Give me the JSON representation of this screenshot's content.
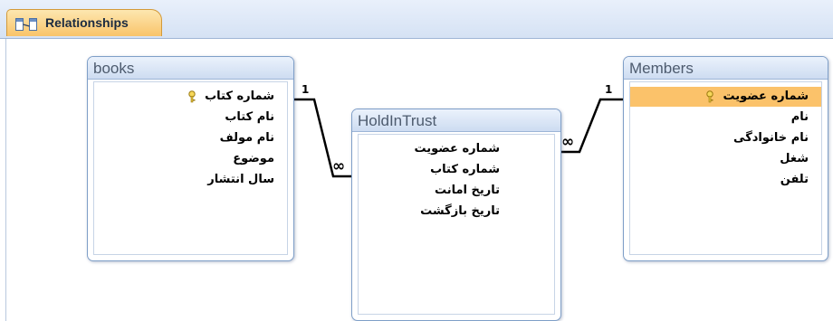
{
  "tab": {
    "label": "Relationships",
    "icon": "relationships-icon"
  },
  "tables": {
    "books": {
      "title": "books",
      "fields": [
        "شماره کتاب",
        "نام کتاب",
        "نام مولف",
        "موضوع",
        "سال انتشار"
      ],
      "primary_key": "شماره کتاب"
    },
    "holdintrust": {
      "title": "HoldInTrust",
      "fields": [
        "شماره عضويت",
        "شماره كتاب",
        "تاريخ امانت",
        "تاريخ بازگشت"
      ]
    },
    "members": {
      "title": "Members",
      "fields": [
        "شماره عضويت",
        "نام",
        "نام خانوادگی",
        "شغل",
        "تلفن"
      ],
      "primary_key": "شماره عضويت",
      "selected_field": "شماره عضويت"
    }
  },
  "relationships": [
    {
      "from": "books",
      "to": "HoldInTrust",
      "one_label": "1",
      "many_label": "∞"
    },
    {
      "from": "Members",
      "to": "HoldInTrust",
      "one_label": "1",
      "many_label": "∞"
    }
  ],
  "colors": {
    "accent": "#f9c46a",
    "header": "#d5e2f4",
    "selected": "#fbc26a"
  }
}
